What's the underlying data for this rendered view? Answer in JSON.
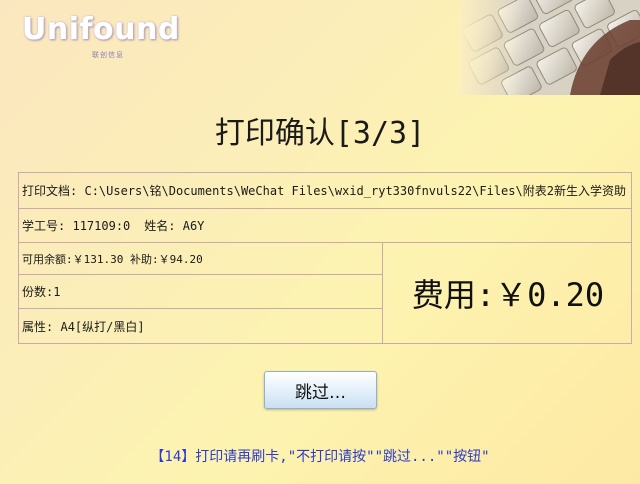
{
  "logo": {
    "wordmark": "Unifound",
    "tagline": "联创信息"
  },
  "page": {
    "title": "打印确认[3/3]"
  },
  "details": {
    "file_label": "打印文档:",
    "file_path": "C:\\Users\\铭\\Documents\\WeChat Files\\wxid_ryt330fnvuls22\\Files\\附表2新生入学资助",
    "student_id_label": "学工号:",
    "student_id_value": "117109:0",
    "name_label": "姓名:",
    "name_value": "A6Y",
    "balance_label": "可用余额:",
    "balance_value": "￥131.30",
    "subsidy_label": "补助:",
    "subsidy_value": "￥94.20",
    "copies_label": "份数:",
    "copies_value": "1",
    "attr_label": "属性:",
    "attr_value": "A4[纵打/黑白]"
  },
  "fee": {
    "label": "费用:",
    "value": "￥0.20"
  },
  "actions": {
    "skip_label": "跳过…"
  },
  "hint": {
    "text": "【14】打印请再刷卡,\"不打印请按\"\"跳过...\"\"按钮\""
  }
}
